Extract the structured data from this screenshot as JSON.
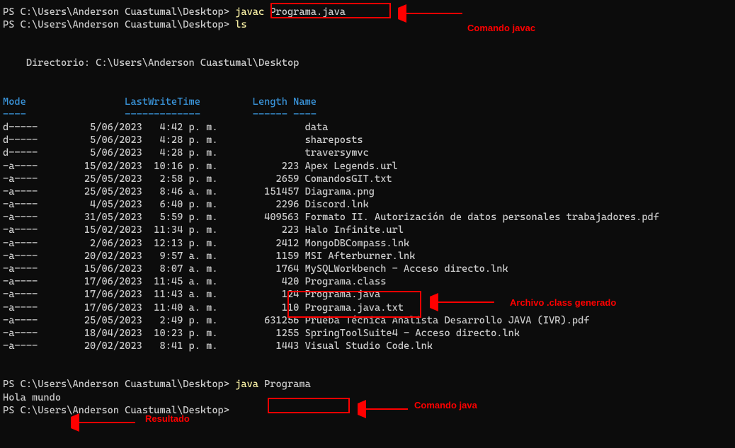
{
  "prompt_prefix": "PS C:\\Users\\Anderson Cuastumal\\Desktop> ",
  "line1_cmd_javac": "javac",
  "line1_cmd_arg": " Programa.java",
  "line2_cmd_ls": "ls",
  "directory_header": "    Directorio: C:\\Users\\Anderson Cuastumal\\Desktop",
  "header_mode": "Mode",
  "header_lwt": "LastWriteTime",
  "header_length": "Length",
  "header_name": "Name",
  "header_line": "Mode                 LastWriteTime         Length Name",
  "sep_line": "----                 -------------         ------ ----",
  "rows": [
    {
      "mode": "d-----",
      "date": "5/06/2023",
      "time": "4:42 p. m.",
      "len": "",
      "name": "data"
    },
    {
      "mode": "d-----",
      "date": "5/06/2023",
      "time": "4:28 p. m.",
      "len": "",
      "name": "shareposts"
    },
    {
      "mode": "d-----",
      "date": "5/06/2023",
      "time": "4:28 p. m.",
      "len": "",
      "name": "traversymvc"
    },
    {
      "mode": "-a----",
      "date": "15/02/2023",
      "time": "10:16 p. m.",
      "len": "223",
      "name": "Apex Legends.url"
    },
    {
      "mode": "-a----",
      "date": "25/05/2023",
      "time": "2:58 p. m.",
      "len": "2659",
      "name": "ComandosGIT.txt"
    },
    {
      "mode": "-a----",
      "date": "25/05/2023",
      "time": "8:46 a. m.",
      "len": "151457",
      "name": "Diagrama.png"
    },
    {
      "mode": "-a----",
      "date": "4/05/2023",
      "time": "6:40 p. m.",
      "len": "2296",
      "name": "Discord.lnk"
    },
    {
      "mode": "-a----",
      "date": "31/05/2023",
      "time": "5:59 p. m.",
      "len": "409563",
      "name": "Formato II. Autorización de datos personales trabajadores.pdf"
    },
    {
      "mode": "-a----",
      "date": "15/02/2023",
      "time": "11:34 p. m.",
      "len": "223",
      "name": "Halo Infinite.url"
    },
    {
      "mode": "-a----",
      "date": "2/06/2023",
      "time": "12:13 p. m.",
      "len": "2412",
      "name": "MongoDBCompass.lnk"
    },
    {
      "mode": "-a----",
      "date": "20/02/2023",
      "time": "9:57 a. m.",
      "len": "1159",
      "name": "MSI Afterburner.lnk"
    },
    {
      "mode": "-a----",
      "date": "15/06/2023",
      "time": "8:07 a. m.",
      "len": "1764",
      "name": "MySQLWorkbench - Acceso directo.lnk"
    },
    {
      "mode": "-a----",
      "date": "17/06/2023",
      "time": "11:45 a. m.",
      "len": "420",
      "name": "Programa.class"
    },
    {
      "mode": "-a----",
      "date": "17/06/2023",
      "time": "11:43 a. m.",
      "len": "124",
      "name": "Programa.java"
    },
    {
      "mode": "-a----",
      "date": "17/06/2023",
      "time": "11:40 a. m.",
      "len": "110",
      "name": "Programa.java.txt"
    },
    {
      "mode": "-a----",
      "date": "25/05/2023",
      "time": "2:49 p. m.",
      "len": "631256",
      "name": "Prueba Técnica Analista Desarrollo JAVA (IVR).pdf"
    },
    {
      "mode": "-a----",
      "date": "18/04/2023",
      "time": "10:23 p. m.",
      "len": "1255",
      "name": "SpringToolSuite4 - Acceso directo.lnk"
    },
    {
      "mode": "-a----",
      "date": "20/02/2023",
      "time": "8:41 p. m.",
      "len": "1443",
      "name": "Visual Studio Code.lnk"
    }
  ],
  "line3_cmd_java": "java",
  "line3_cmd_arg": " Programa",
  "output_result": "Hola mundo",
  "annotations": {
    "javac_label": "Comando javac",
    "class_label": "Archivo .class generado",
    "java_label": "Comando java",
    "result_label": "Resultado"
  }
}
